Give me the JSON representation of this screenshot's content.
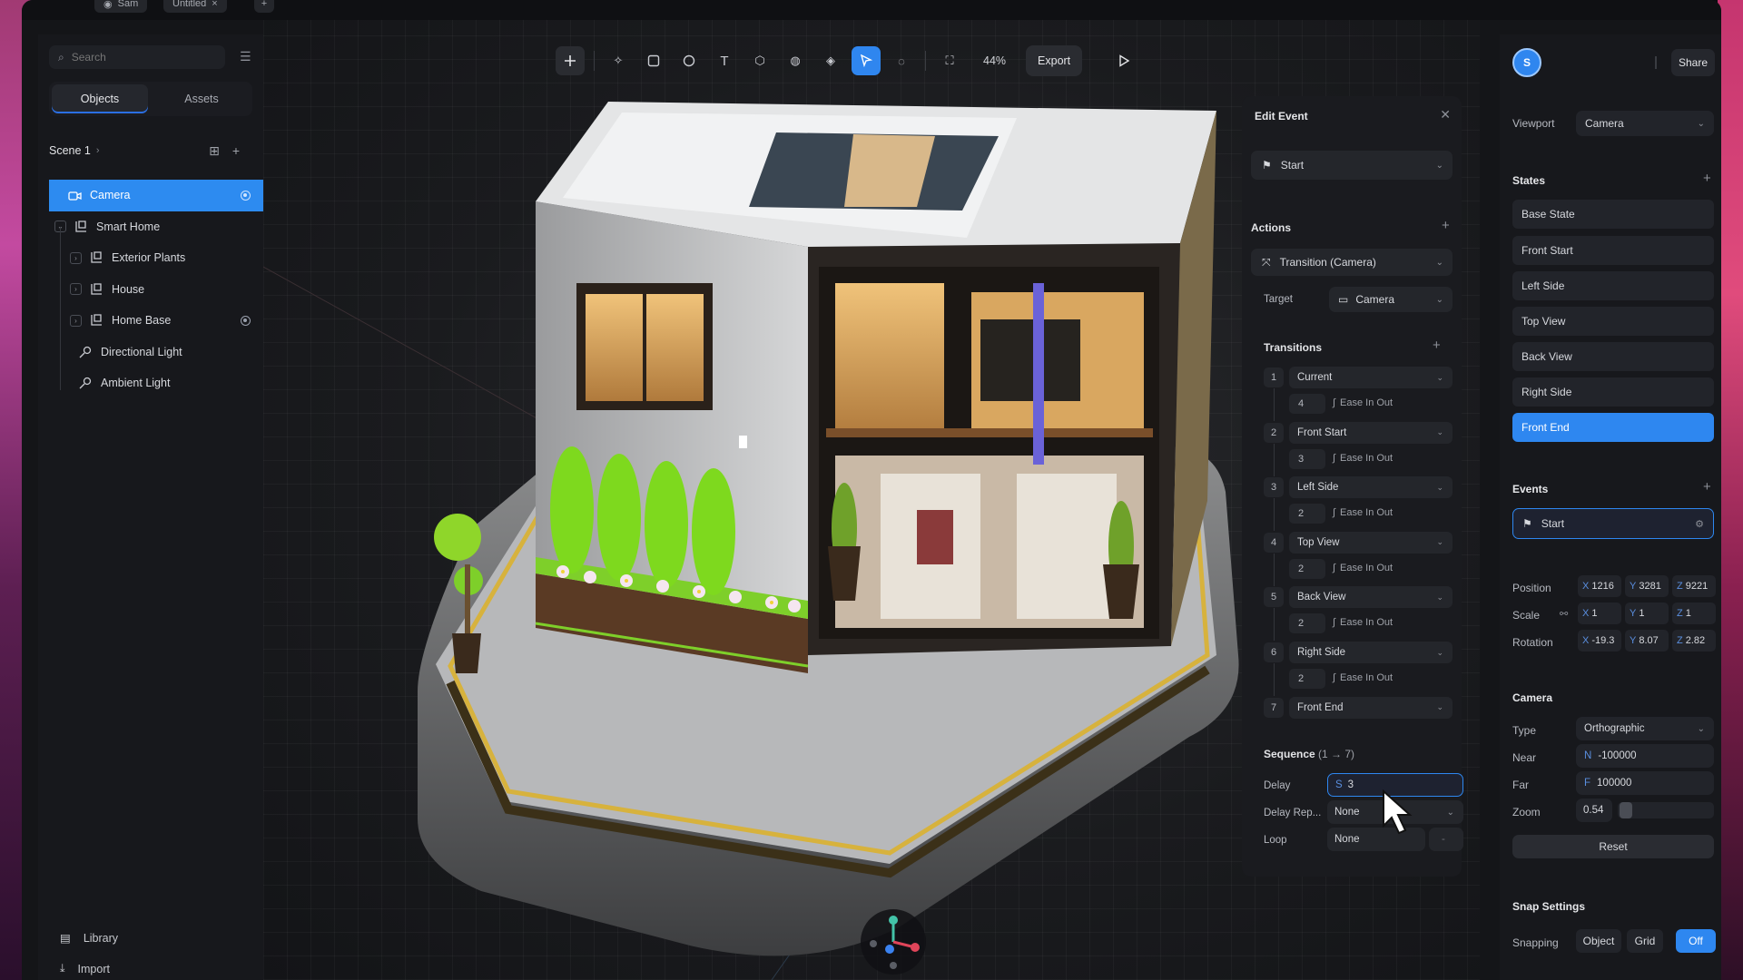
{
  "topbar": {
    "user_chip": "Sam",
    "file_chip": "Untitled"
  },
  "left": {
    "search_placeholder": "Search",
    "tabs": [
      {
        "label": "Objects"
      },
      {
        "label": "Assets"
      }
    ],
    "scene_label": "Scene 1",
    "tree": [
      {
        "label": "Camera"
      },
      {
        "label": "Smart Home"
      },
      {
        "label": "Exterior Plants"
      },
      {
        "label": "House"
      },
      {
        "label": "Home Base"
      },
      {
        "label": "Directional Light"
      },
      {
        "label": "Ambient Light"
      }
    ],
    "library_label": "Library",
    "import_label": "Import"
  },
  "toolbar": {
    "zoom": "44%",
    "export_label": "Export"
  },
  "edit_event": {
    "title": "Edit Event",
    "trigger": "Start",
    "actions_label": "Actions",
    "action_value": "Transition (Camera)",
    "target_label": "Target",
    "target_value": "Camera",
    "transitions_label": "Transitions",
    "transitions": [
      {
        "num": "1",
        "state": "Current",
        "duration": "4",
        "ease": "Ease In Out"
      },
      {
        "num": "2",
        "state": "Front Start",
        "duration": "3",
        "ease": "Ease In Out"
      },
      {
        "num": "3",
        "state": "Left Side",
        "duration": "2",
        "ease": "Ease In Out"
      },
      {
        "num": "4",
        "state": "Top View",
        "duration": "2",
        "ease": "Ease In Out"
      },
      {
        "num": "5",
        "state": "Back View",
        "duration": "2",
        "ease": "Ease In Out"
      },
      {
        "num": "6",
        "state": "Right Side",
        "duration": "2",
        "ease": "Ease In Out"
      },
      {
        "num": "7",
        "state": "Front End"
      }
    ],
    "sequence_label": "Sequence",
    "sequence_range": "(1 → 7)",
    "delay_label": "Delay",
    "delay_prefix": "S",
    "delay_value": "3",
    "delay_rep_label": "Delay Rep...",
    "delay_rep_value": "None",
    "loop_label": "Loop",
    "loop_value": "None",
    "loop_extra": "-"
  },
  "right": {
    "avatar_initial": "S",
    "share_label": "Share",
    "viewport_label": "Viewport",
    "viewport_value": "Camera",
    "states_label": "States",
    "states": [
      {
        "label": "Base State"
      },
      {
        "label": "Front Start"
      },
      {
        "label": "Left Side"
      },
      {
        "label": "Top View"
      },
      {
        "label": "Back View"
      },
      {
        "label": "Right Side"
      },
      {
        "label": "Front End"
      }
    ],
    "events_label": "Events",
    "event_value": "Start",
    "position_label": "Position",
    "position": {
      "x": "1216",
      "y": "3281",
      "z": "9221"
    },
    "scale_label": "Scale",
    "scale": {
      "x": "1",
      "y": "1",
      "z": "1"
    },
    "rotation_label": "Rotation",
    "rotation": {
      "x": "-19.3",
      "y": "8.07",
      "z": "2.82"
    },
    "camera_label": "Camera",
    "type_label": "Type",
    "type_value": "Orthographic",
    "near_label": "Near",
    "near_prefix": "N",
    "near_value": "-100000",
    "far_label": "Far",
    "far_prefix": "F",
    "far_value": "100000",
    "zoom_label": "Zoom",
    "zoom_value": "0.54",
    "reset_label": "Reset",
    "snap_label": "Snap Settings",
    "snapping_label": "Snapping",
    "snap_options": [
      {
        "label": "Object"
      },
      {
        "label": "Grid"
      },
      {
        "label": "Off"
      }
    ]
  },
  "colors": {
    "accent": "#2e87f0",
    "panel": "#17181c",
    "field": "#24262b"
  }
}
